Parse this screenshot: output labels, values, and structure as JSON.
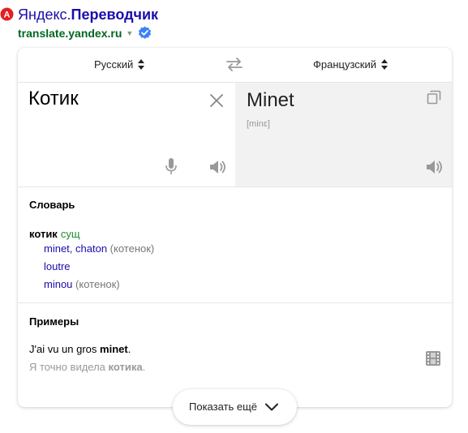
{
  "result": {
    "title_plain": "Яндекс.",
    "title_bold": "Переводчик",
    "url": "translate.yandex.ru",
    "favicon": "yandex-favicon",
    "verified_icon": "verified-check-icon"
  },
  "translator": {
    "source_lang": "Русский",
    "target_lang": "Французский",
    "source_text": "Котик",
    "translation": "Minet",
    "transcription": "[minɛ]",
    "colors": {
      "link": "#1a0dab",
      "url": "#006621",
      "pos": "#1e8a2e",
      "target_bg": "#f2f2f2"
    }
  },
  "dictionary": {
    "heading": "Словарь",
    "word": "котик",
    "pos": "сущ",
    "items": [
      {
        "text": "minet, chaton",
        "note": "(котенок)"
      },
      {
        "text": "loutre",
        "note": ""
      },
      {
        "text": "minou",
        "note": "(котенок)"
      }
    ]
  },
  "examples": {
    "heading": "Примеры",
    "src_before": "J'ai vu un gros ",
    "src_bold": "minet",
    "src_after": ".",
    "dst_before": "Я точно видела ",
    "dst_bold": "котика",
    "dst_after": "."
  },
  "more_button": {
    "label": "Показать ещё"
  }
}
